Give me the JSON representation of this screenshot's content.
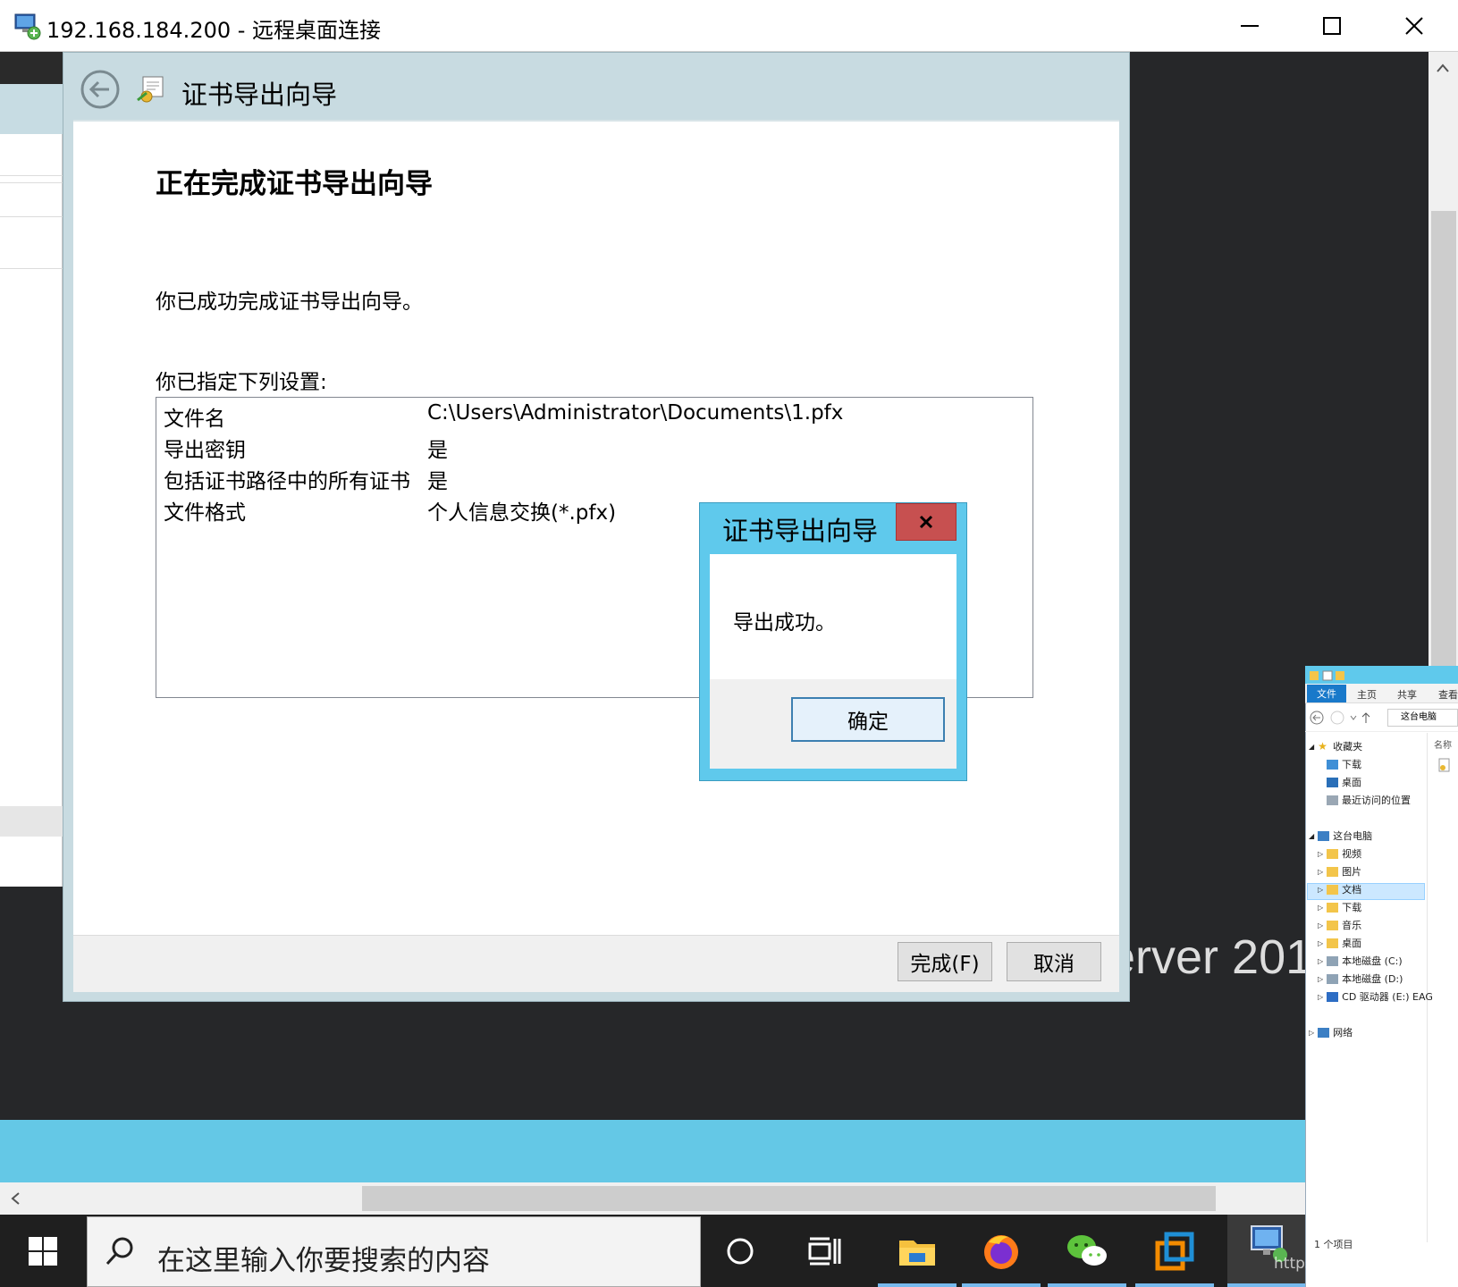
{
  "rdp": {
    "title": "192.168.184.200 - 远程桌面连接",
    "minimize_icon": "minimize-icon",
    "maximize_icon": "maximize-icon",
    "close_icon": "close-icon"
  },
  "wizard": {
    "title": "证书导出向导",
    "heading": "正在完成证书导出向导",
    "success_text": "你已成功完成证书导出向导。",
    "settings_label": "你已指定下列设置:",
    "settings": [
      {
        "key": "文件名",
        "value": "C:\\Users\\Administrator\\Documents\\1.pfx"
      },
      {
        "key": "导出密钥",
        "value": "是"
      },
      {
        "key": "包括证书路径中的所有证书",
        "value": "是"
      },
      {
        "key": "文件格式",
        "value": "个人信息交换(*.pfx)"
      }
    ],
    "finish_button": "完成(F)",
    "cancel_button": "取消"
  },
  "message_box": {
    "title": "证书导出向导",
    "close_label": "x",
    "text": "导出成功。",
    "ok_button": "确定"
  },
  "background": {
    "brand_text": "erver 201"
  },
  "explorer": {
    "tabs": [
      "文件",
      "主页",
      "共享",
      "查看"
    ],
    "address": "这台电脑",
    "name_column": "名称",
    "nav_items": [
      {
        "label": "收藏夹",
        "icon": "star-icon"
      },
      {
        "label": "下载",
        "icon": "download-folder-icon"
      },
      {
        "label": "桌面",
        "icon": "desktop-icon"
      },
      {
        "label": "最近访问的位置",
        "icon": "recent-icon"
      },
      {
        "label": "这台电脑",
        "icon": "computer-icon"
      },
      {
        "label": "视频",
        "icon": "folder-icon"
      },
      {
        "label": "图片",
        "icon": "folder-icon"
      },
      {
        "label": "文档",
        "icon": "folder-icon"
      },
      {
        "label": "下载",
        "icon": "folder-icon"
      },
      {
        "label": "音乐",
        "icon": "folder-icon"
      },
      {
        "label": "桌面",
        "icon": "folder-icon"
      },
      {
        "label": "本地磁盘 (C:)",
        "icon": "drive-icon"
      },
      {
        "label": "本地磁盘 (D:)",
        "icon": "drive-icon"
      },
      {
        "label": "CD 驱动器 (E:) EAG",
        "icon": "cd-drive-icon"
      },
      {
        "label": "网络",
        "icon": "network-icon"
      }
    ],
    "status": "1 个项目"
  },
  "taskbar": {
    "search_placeholder": "在这里输入你要搜索的内容",
    "items": [
      "start-icon",
      "cortana-icon",
      "task-view-icon",
      "file-explorer-icon",
      "firefox-icon",
      "wechat-icon",
      "vmware-icon",
      "remote-desktop-icon"
    ]
  },
  "watermark": "https://blog.csdn.net/Kaeee"
}
